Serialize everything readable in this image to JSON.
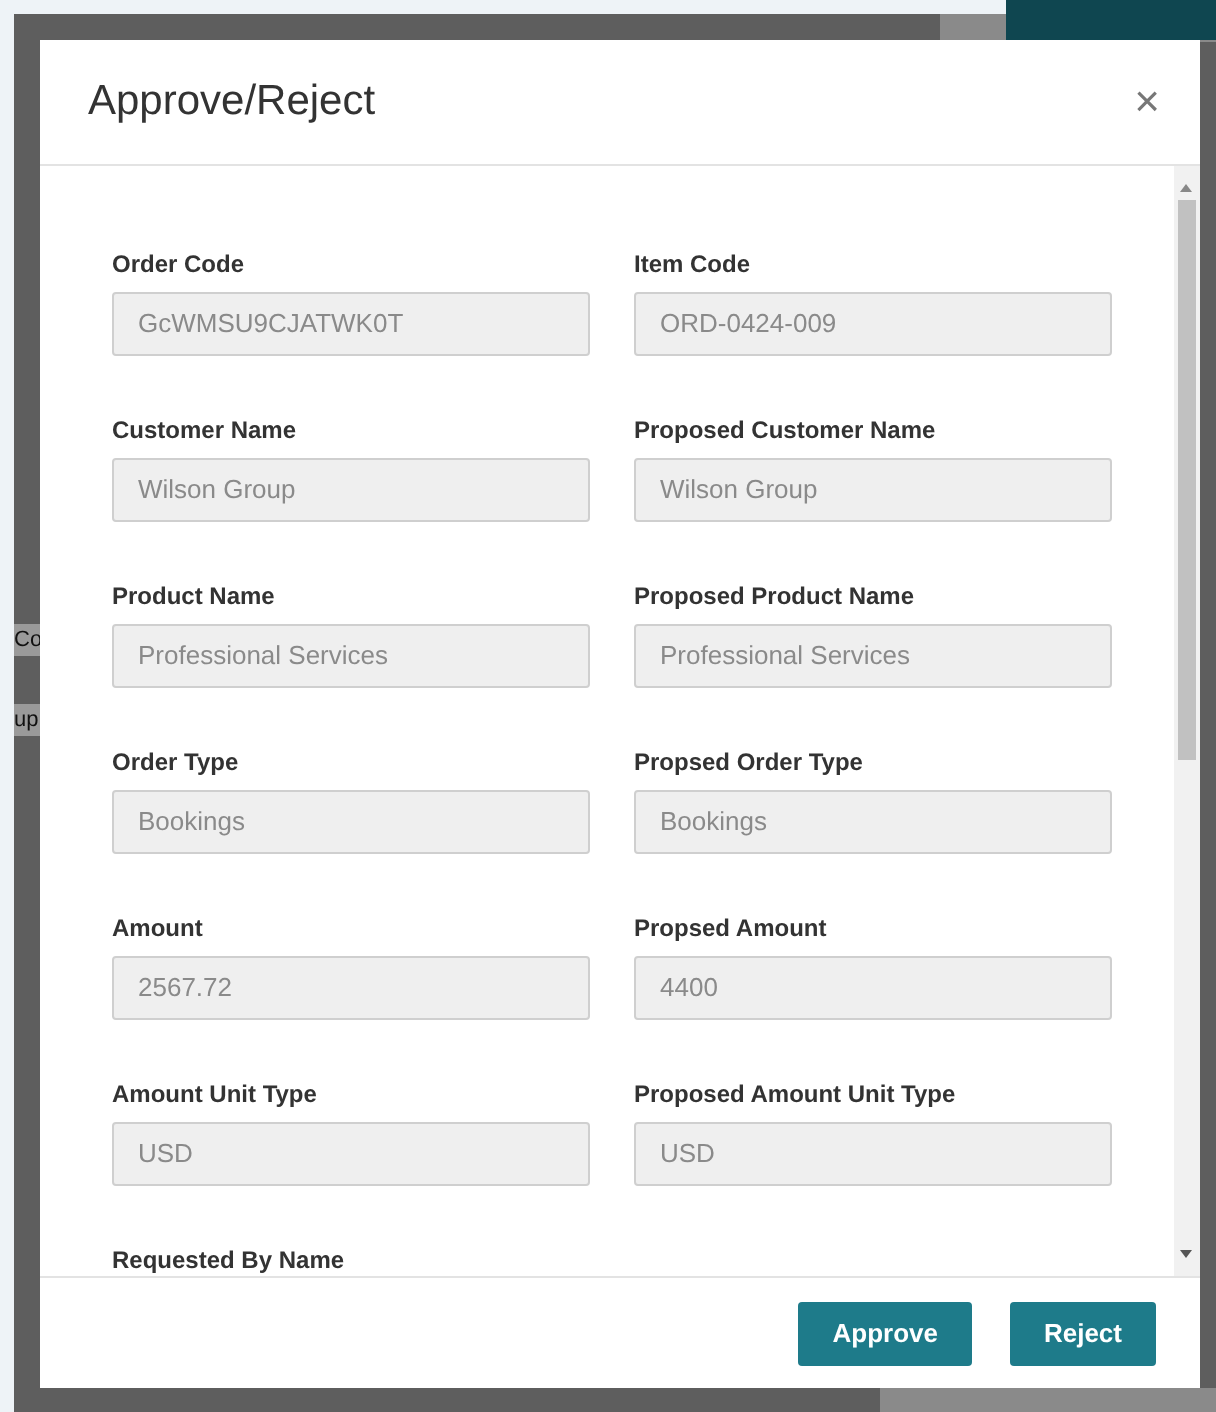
{
  "background_fragments": [
    "Co",
    "up"
  ],
  "dialog": {
    "title": "Approve/Reject",
    "close": "×"
  },
  "fields": [
    {
      "label": "Order Code",
      "value": "GcWMSU9CJATWK0T"
    },
    {
      "label": "Item Code",
      "value": "ORD-0424-009"
    },
    {
      "label": "Customer Name",
      "value": "Wilson Group"
    },
    {
      "label": "Proposed Customer Name",
      "value": "Wilson Group"
    },
    {
      "label": "Product Name",
      "value": "Professional Services"
    },
    {
      "label": "Proposed Product Name",
      "value": "Professional Services"
    },
    {
      "label": "Order Type",
      "value": "Bookings"
    },
    {
      "label": "Propsed Order Type",
      "value": "Bookings"
    },
    {
      "label": "Amount",
      "value": "2567.72"
    },
    {
      "label": "Propsed Amount",
      "value": "4400"
    },
    {
      "label": "Amount Unit Type",
      "value": "USD"
    },
    {
      "label": "Proposed Amount Unit Type",
      "value": "USD"
    },
    {
      "label": "Requested By Name"
    }
  ],
  "buttons": [
    "Approve",
    "Reject"
  ]
}
